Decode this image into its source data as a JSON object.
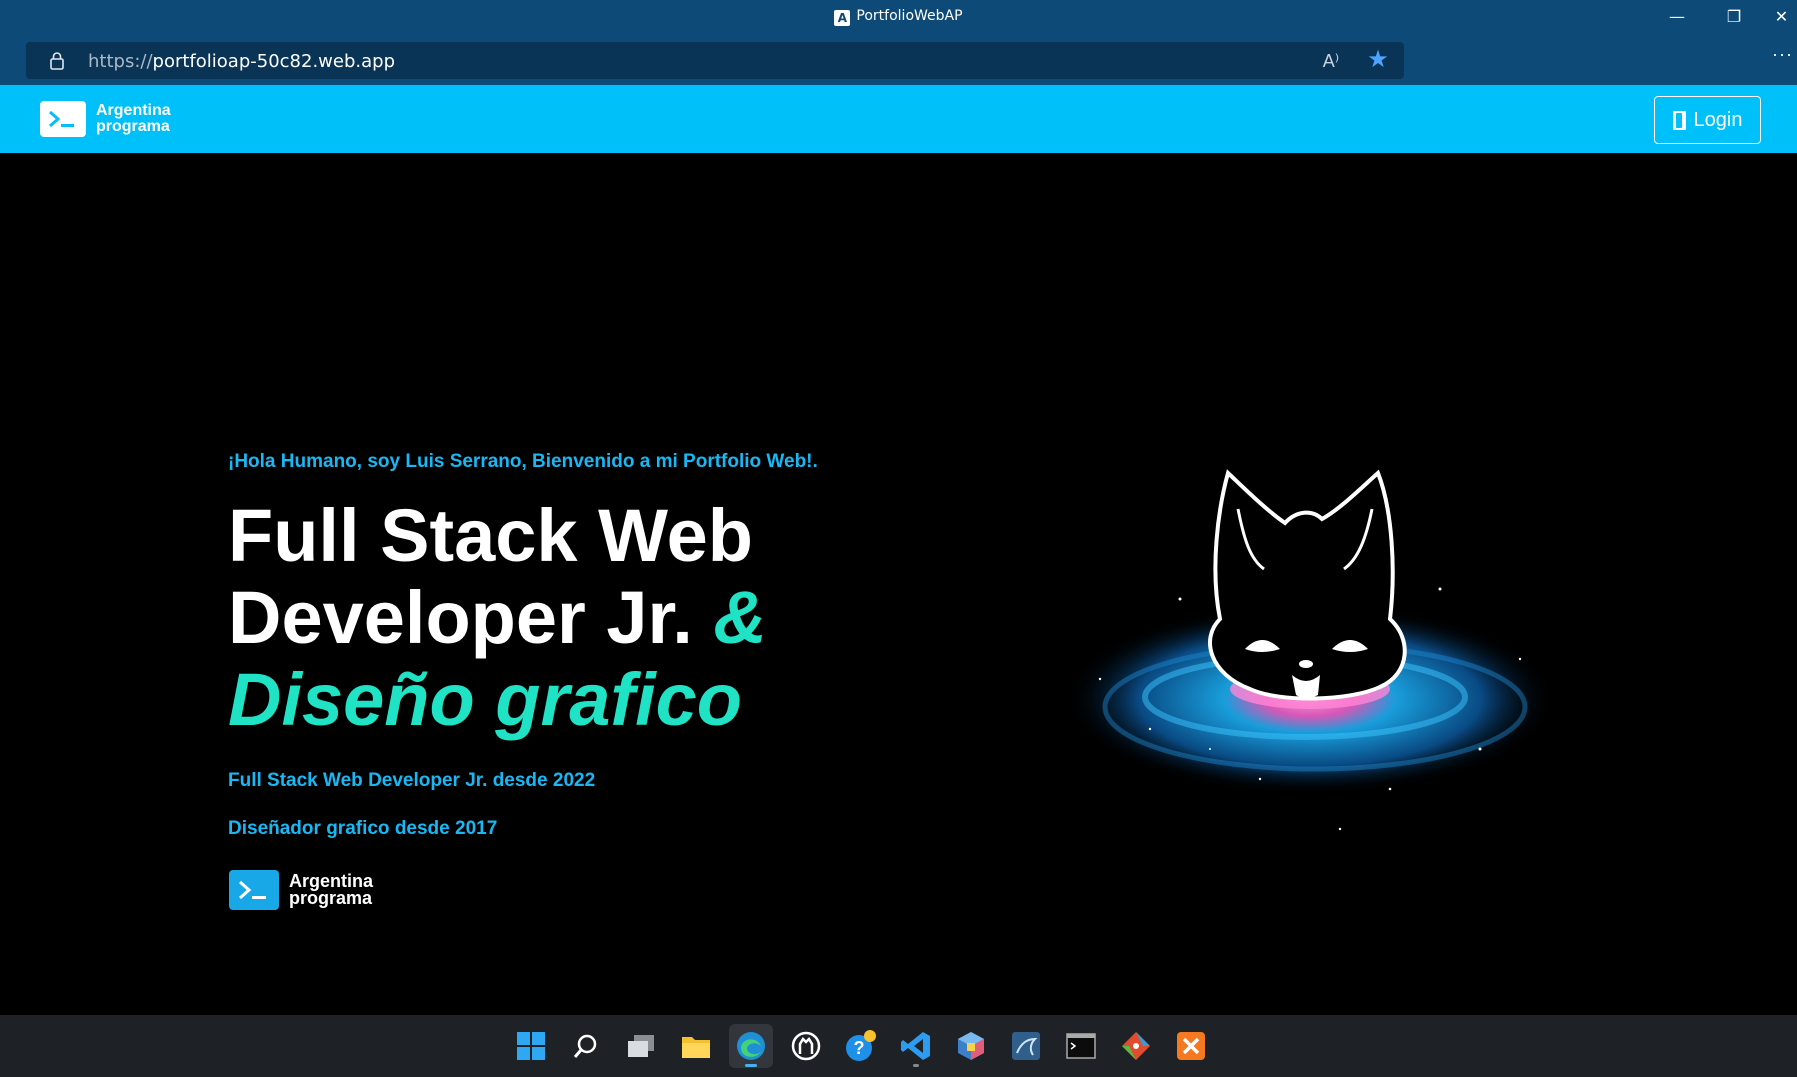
{
  "window": {
    "title": "PortfolioWebAP",
    "app_icon_letter": "A",
    "controls": {
      "minimize": "—",
      "restore": "❐",
      "close": "✕"
    }
  },
  "browser": {
    "url_protocol": "https://",
    "url_host": "portfolioap-50c82.web.app",
    "read_aloud_glyph": "A⁾",
    "favorite_glyph": "★",
    "more_glyph": "···"
  },
  "navbar": {
    "brand_line1": "Argentina",
    "brand_line2": "programa",
    "login_label": "Login",
    "bg_color": "#00c0fa"
  },
  "hero": {
    "greeting": "¡Hola Humano, soy Luis Serrano, Bienvenido a mi Portfolio Web!.",
    "headline_line1": "Full Stack Web",
    "headline_line2": "Developer Jr.",
    "headline_amp": "&",
    "headline_line3": "Diseño grafico",
    "sub1": "Full Stack Web Developer Jr. desde 2022",
    "sub2": "Diseñador grafico desde 2017",
    "brand_line1": "Argentina",
    "brand_line2": "programa",
    "accent_color": "#20e3c6",
    "text_blue": "#18b8f4"
  },
  "taskbar": {
    "icons": [
      "windows-start-icon",
      "search-icon",
      "task-view-icon",
      "file-explorer-icon",
      "edge-browser-icon",
      "github-desktop-icon",
      "help-icon",
      "vscode-icon",
      "virtualbox-icon",
      "mysql-workbench-icon",
      "terminal-icon",
      "git-icon",
      "xampp-icon"
    ]
  }
}
